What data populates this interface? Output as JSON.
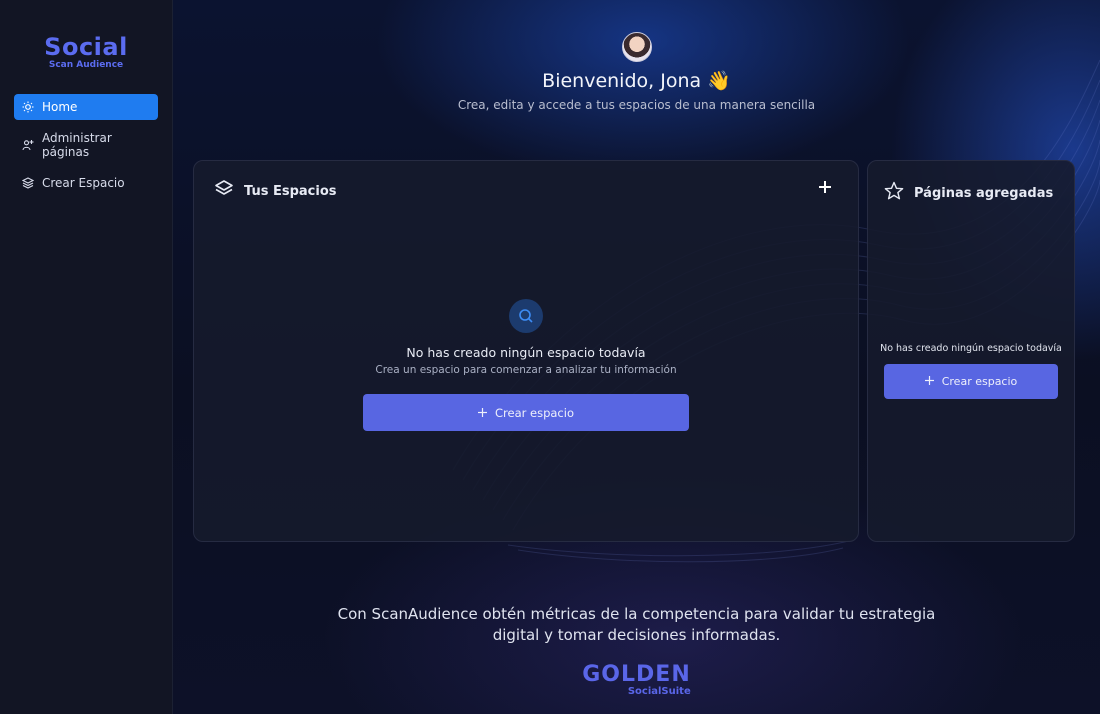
{
  "sidebar": {
    "brand_title": "Social",
    "brand_sub": "Scan Audience",
    "items": [
      {
        "label": "Home",
        "icon": "sun-icon",
        "active": true
      },
      {
        "label": "Administrar páginas",
        "icon": "user-plus-icon",
        "active": false
      },
      {
        "label": "Crear Espacio",
        "icon": "layers-icon",
        "active": false
      }
    ]
  },
  "header": {
    "welcome": "Bienvenido, Jona 👋",
    "subtitle": "Crea, edita y accede a tus espacios de una manera sencilla"
  },
  "spaces_panel": {
    "title": "Tus Espacios",
    "empty_title": "No has creado ningún espacio todavía",
    "empty_sub": "Crea un espacio para comenzar a analizar tu información",
    "button_label": "Crear espacio"
  },
  "pages_panel": {
    "title": "Páginas agregadas",
    "empty_title": "No has creado ningún espacio todavía",
    "button_label": "Crear espacio"
  },
  "footer": {
    "text_line1": "Con ScanAudience obtén métricas de la competencia para validar tu estrategia",
    "text_line2": "digital y tomar decisiones informadas.",
    "logo_main": "GOLDEN",
    "logo_sub": "SocialSuite"
  },
  "colors": {
    "accent": "#1f7cf0",
    "button": "#5866e2",
    "brand": "#5b6cf0"
  }
}
